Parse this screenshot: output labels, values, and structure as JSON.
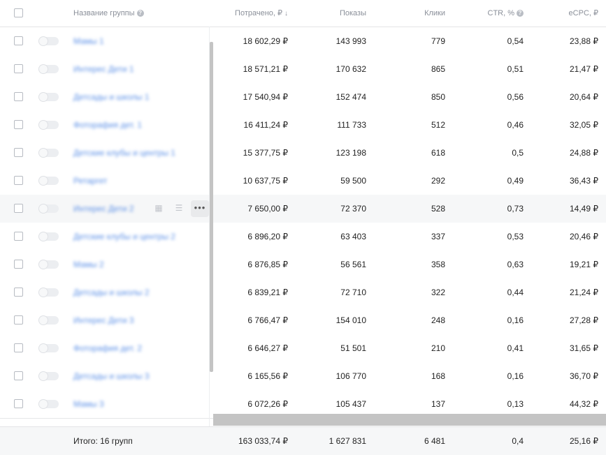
{
  "header": {
    "name_label": "Название группы",
    "spent_label": "Потрачено, ₽",
    "shows_label": "Показы",
    "clicks_label": "Клики",
    "ctr_label": "CTR, %",
    "ecpc_label": "eCPC, ₽",
    "sort_glyph": "↓",
    "help_glyph": "?"
  },
  "rows": [
    {
      "name": "Мамы 1",
      "spent": "18 602,29 ₽",
      "shows": "143 993",
      "clicks": "779",
      "ctr": "0,54",
      "ecpc": "23,88 ₽"
    },
    {
      "name": "Интерес Дети 1",
      "spent": "18 571,21 ₽",
      "shows": "170 632",
      "clicks": "865",
      "ctr": "0,51",
      "ecpc": "21,47 ₽"
    },
    {
      "name": "Детсады и школы 1",
      "spent": "17 540,94 ₽",
      "shows": "152 474",
      "clicks": "850",
      "ctr": "0,56",
      "ecpc": "20,64 ₽"
    },
    {
      "name": "Фоторафия дет. 1",
      "spent": "16 411,24 ₽",
      "shows": "111 733",
      "clicks": "512",
      "ctr": "0,46",
      "ecpc": "32,05 ₽"
    },
    {
      "name": "Детские клубы и центры 1",
      "spent": "15 377,75 ₽",
      "shows": "123 198",
      "clicks": "618",
      "ctr": "0,5",
      "ecpc": "24,88 ₽"
    },
    {
      "name": "Ретаргет",
      "spent": "10 637,75 ₽",
      "shows": "59 500",
      "clicks": "292",
      "ctr": "0,49",
      "ecpc": "36,43 ₽"
    },
    {
      "name": "Интерес Дети 2",
      "spent": "7 650,00 ₽",
      "shows": "72 370",
      "clicks": "528",
      "ctr": "0,73",
      "ecpc": "14,49 ₽"
    },
    {
      "name": "Детские клубы и центры 2",
      "spent": "6 896,20 ₽",
      "shows": "63 403",
      "clicks": "337",
      "ctr": "0,53",
      "ecpc": "20,46 ₽"
    },
    {
      "name": "Мамы 2",
      "spent": "6 876,85 ₽",
      "shows": "56 561",
      "clicks": "358",
      "ctr": "0,63",
      "ecpc": "19,21 ₽"
    },
    {
      "name": "Детсады и школы 2",
      "spent": "6 839,21 ₽",
      "shows": "72 710",
      "clicks": "322",
      "ctr": "0,44",
      "ecpc": "21,24 ₽"
    },
    {
      "name": "Интерес Дети 3",
      "spent": "6 766,47 ₽",
      "shows": "154 010",
      "clicks": "248",
      "ctr": "0,16",
      "ecpc": "27,28 ₽"
    },
    {
      "name": "Фоторафия дет. 2",
      "spent": "6 646,27 ₽",
      "shows": "51 501",
      "clicks": "210",
      "ctr": "0,41",
      "ecpc": "31,65 ₽"
    },
    {
      "name": "Детсады и школы 3",
      "spent": "6 165,56 ₽",
      "shows": "106 770",
      "clicks": "168",
      "ctr": "0,16",
      "ecpc": "36,70 ₽"
    },
    {
      "name": "Мамы 3",
      "spent": "6 072,26 ₽",
      "shows": "105 437",
      "clicks": "137",
      "ctr": "0,13",
      "ecpc": "44,32 ₽"
    }
  ],
  "hover_row_index": 6,
  "row_actions": {
    "stats_icon": "stats-icon",
    "filter_icon": "filter-icon",
    "more_glyph": "•••"
  },
  "footer": {
    "total_label": "Итого: 16 групп",
    "spent": "163 033,74 ₽",
    "shows": "1 627 831",
    "clicks": "6 481",
    "ctr": "0,4",
    "ecpc": "25,16 ₽"
  }
}
